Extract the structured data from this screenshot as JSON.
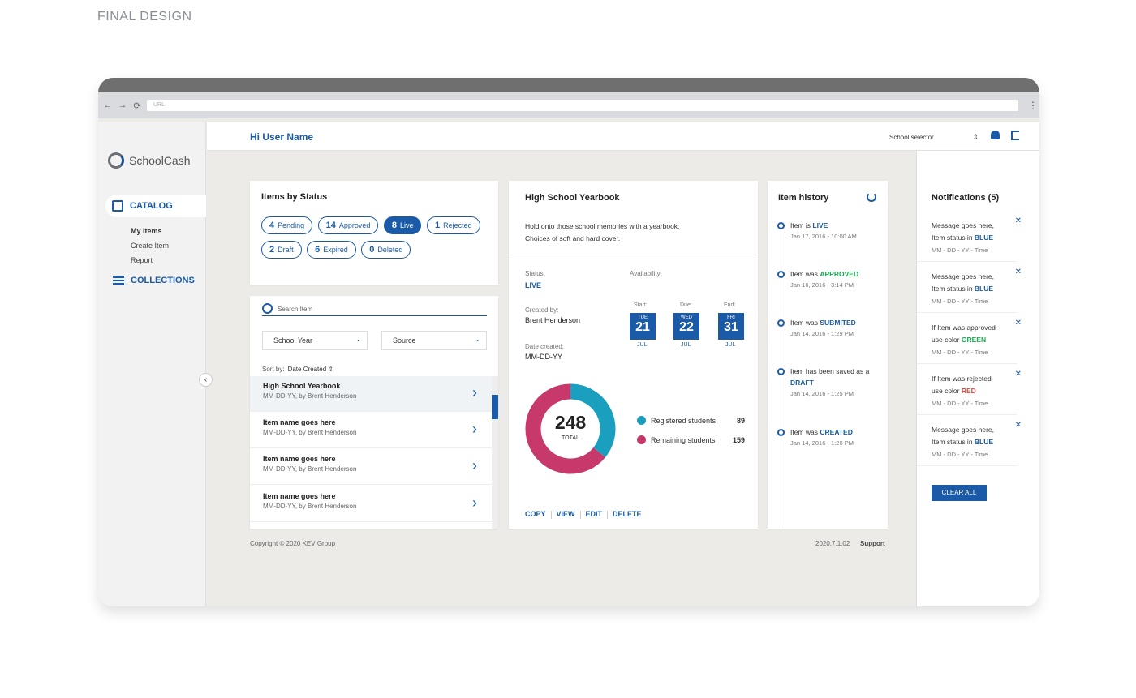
{
  "page_caption": "FINAL DESIGN",
  "browser": {
    "url_placeholder": "URL",
    "back": "←",
    "forward": "→",
    "reload": "⟳",
    "menu": "⋮"
  },
  "app": {
    "brand": "SchoolCash",
    "greeting": "Hi User Name",
    "school_selector": "School selector"
  },
  "sidebar": {
    "catalog": "CATALOG",
    "collections": "COLLECTIONS",
    "items": [
      "My Items",
      "Create Item",
      "Report"
    ]
  },
  "status": {
    "title": "Items by Status",
    "pills": [
      {
        "count": "4",
        "label": "Pending"
      },
      {
        "count": "14",
        "label": "Approved"
      },
      {
        "count": "8",
        "label": "Live"
      },
      {
        "count": "1",
        "label": "Rejected"
      },
      {
        "count": "2",
        "label": "Draft"
      },
      {
        "count": "6",
        "label": "Expired"
      },
      {
        "count": "0",
        "label": "Deleted"
      }
    ]
  },
  "list": {
    "search_placeholder": "Search Item",
    "filter1": "School Year",
    "filter2": "Source",
    "sort_label": "Sort by:",
    "sort_value": "Date Created",
    "rows": [
      {
        "name": "High School Yearbook",
        "meta": "MM-DD-YY, by Brent Henderson"
      },
      {
        "name": "Item name goes here",
        "meta": "MM-DD-YY, by Brent Henderson"
      },
      {
        "name": "Item name goes here",
        "meta": "MM-DD-YY, by Brent Henderson"
      },
      {
        "name": "Item name goes here",
        "meta": "MM-DD-YY, by Brent Henderson"
      }
    ]
  },
  "detail": {
    "title": "High School Yearbook",
    "desc1": "Hold onto those school memories with a yearbook.",
    "desc2": "Choices of soft and hard cover.",
    "status_label": "Status:",
    "status_value": "LIVE",
    "avail_label": "Availability:",
    "created_label": "Created by:",
    "created_value": "Brent Henderson",
    "date_label": "Date created:",
    "date_value": "MM-DD-YY",
    "dates": [
      {
        "label": "Start:",
        "day": "TUE",
        "num": "21",
        "mon": "JUL"
      },
      {
        "label": "Due:",
        "day": "WED",
        "num": "22",
        "mon": "JUL"
      },
      {
        "label": "End:",
        "day": "FRI",
        "num": "31",
        "mon": "JUL"
      }
    ],
    "total": "248",
    "total_label": "TOTAL",
    "legend": [
      {
        "name": "Registered students",
        "value": "89",
        "color": "#1a9fbf"
      },
      {
        "name": "Remaining students",
        "value": "159",
        "color": "#c8396b"
      }
    ],
    "actions": [
      "COPY",
      "VIEW",
      "EDIT",
      "DELETE"
    ]
  },
  "chart_data": {
    "type": "pie",
    "categories": [
      "Registered students",
      "Remaining students"
    ],
    "values": [
      89,
      159
    ],
    "total": 248
  },
  "history": {
    "title": "Item history",
    "events": [
      {
        "pre": "Item is ",
        "status": "LIVE",
        "color": "#1a5aa6",
        "time": "Jan 17, 2016 - 10:00 AM"
      },
      {
        "pre": "Item was ",
        "status": "APPROVED",
        "color": "#1aa64f",
        "time": "Jan 16, 2016 - 3:14 PM"
      },
      {
        "pre": "Item was ",
        "status": "SUBMITED",
        "color": "#1a5aa6",
        "time": "Jan 14, 2016 - 1:29 PM"
      },
      {
        "pre": "Item has been saved as a ",
        "status": "DRAFT",
        "color": "#1a5aa6",
        "time": "Jan 14, 2016 - 1:25 PM"
      },
      {
        "pre": "Item was ",
        "status": "CREATED",
        "color": "#1a5aa6",
        "time": "Jan 14, 2016 - 1:20 PM"
      }
    ]
  },
  "notifications": {
    "title": "Notifications (5)",
    "clear": "CLEAR ALL",
    "items": [
      {
        "l1": "Message goes here,",
        "pre": "Item status in ",
        "word": "BLUE",
        "color": "#1a5aa6",
        "time": "MM - DD - YY - Time"
      },
      {
        "l1": "Message goes here,",
        "pre": "Item status in ",
        "word": "BLUE",
        "color": "#1a5aa6",
        "time": "MM - DD - YY - Time"
      },
      {
        "l1": "If Item was approved",
        "pre": "use color ",
        "word": "GREEN",
        "color": "#1aa64f",
        "time": "MM - DD - YY - Time"
      },
      {
        "l1": "If Item was rejected",
        "pre": "use color ",
        "word": "RED",
        "color": "#e0463a",
        "time": "MM - DD - YY - Time"
      },
      {
        "l1": "Message goes here,",
        "pre": "Item status in ",
        "word": "BLUE",
        "color": "#1a5aa6",
        "time": "MM - DD - YY - Time"
      }
    ]
  },
  "footer": {
    "copyright": "Copyright © 2020 KEV Group",
    "version": "2020.7.1.02",
    "support": "Support"
  }
}
